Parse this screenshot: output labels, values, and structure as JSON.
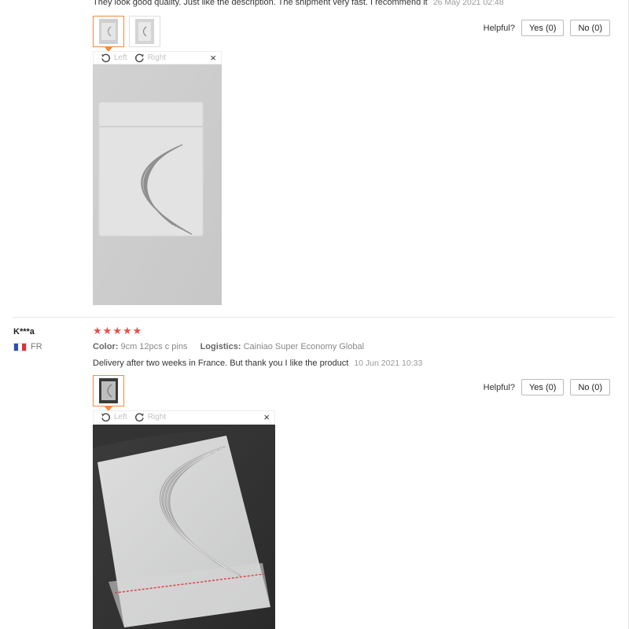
{
  "reviews": [
    {
      "text": "They look good quality. Just like the description. The shipment very fast. I recommend it",
      "date": "26 May 2021 02:48",
      "helpful_label": "Helpful?",
      "yes_label": "Yes (0)",
      "no_label": "No (0)",
      "rotate_left_label": "Left",
      "rotate_right_label": "Right",
      "close_symbol": "×"
    },
    {
      "user_name": "K***a",
      "country": "FR",
      "rating": 5,
      "color_key": "Color:",
      "color_value": "9cm 12pcs c pins",
      "logistics_key": "Logistics:",
      "logistics_value": "Cainiao Super Economy Global",
      "text": "Delivery after two weeks in France. But thank you I like the product",
      "date": "10 Jun 2021 10:33",
      "helpful_label": "Helpful?",
      "yes_label": "Yes (0)",
      "no_label": "No (0)",
      "rotate_left_label": "Left",
      "rotate_right_label": "Right",
      "close_symbol": "×"
    }
  ],
  "icons": {
    "star": "★",
    "rotate_left": "rotate-left-icon",
    "rotate_right": "rotate-right-icon",
    "close": "close-icon",
    "flag": "france-flag-icon"
  },
  "colors": {
    "star": "#e8504a",
    "thumb_active": "#f08b43"
  }
}
